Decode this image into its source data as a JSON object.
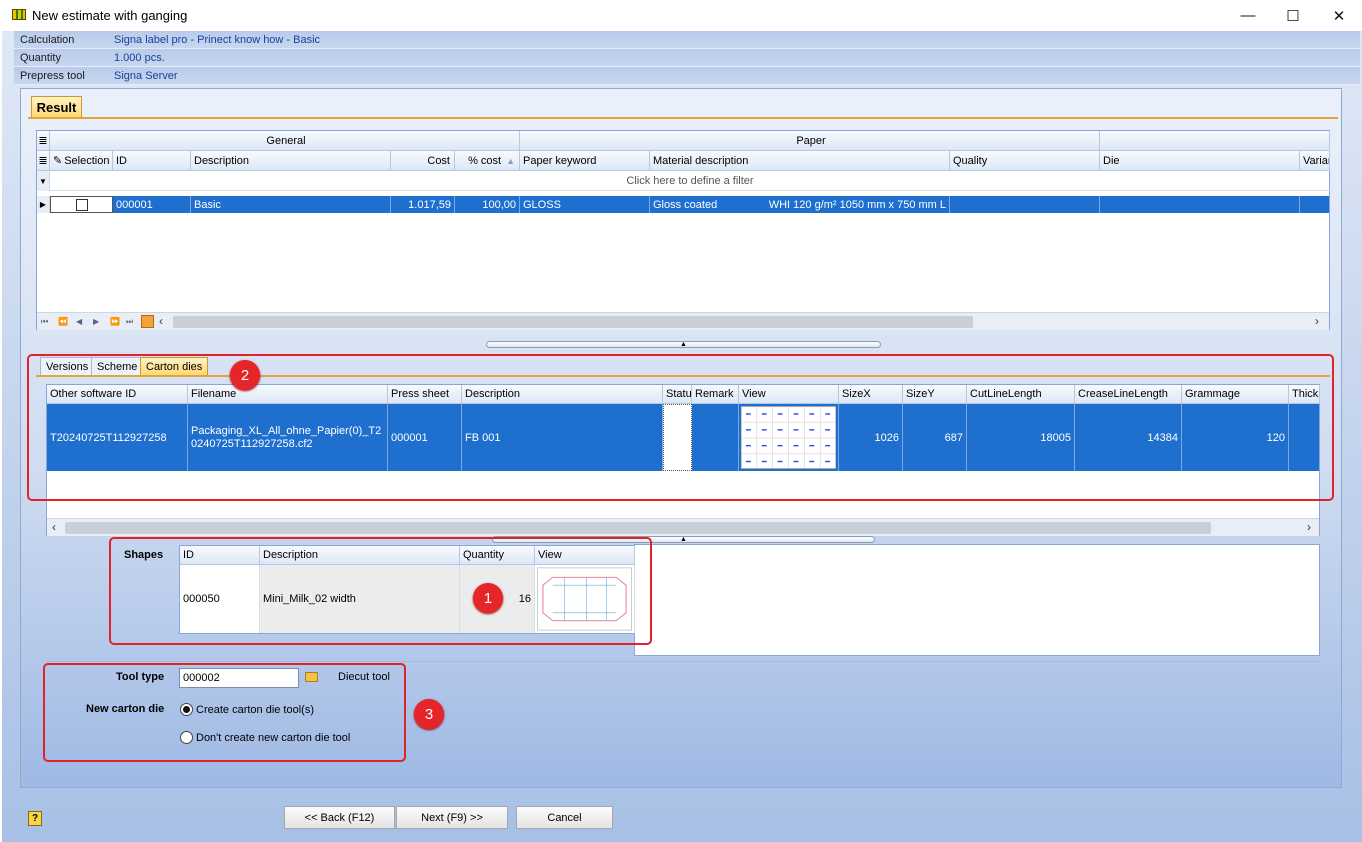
{
  "window": {
    "title": "New estimate with ganging",
    "minimize": "—",
    "maximize": "☐",
    "close": "✕"
  },
  "info": [
    {
      "key": "Calculation",
      "value": "Signa label pro - Prinect know how - Basic"
    },
    {
      "key": "Quantity",
      "value": "1.000 pcs."
    },
    {
      "key": "Prepress tool",
      "value": "Signa Server"
    }
  ],
  "result_tab": "Result",
  "result_grid": {
    "band_general": "General",
    "band_paper": "Paper",
    "columns": [
      "Selection",
      "ID",
      "Description",
      "Cost",
      "% cost",
      "Paper keyword",
      "Material description",
      "Quality",
      "Die",
      "Variant"
    ],
    "filter_text": "Click here to define a filter",
    "row": {
      "selected": true,
      "id": "000001",
      "description": "Basic",
      "cost": "1.017,59",
      "pct_cost": "100,00",
      "paper_keyword": "GLOSS",
      "material_description": "Gloss coated",
      "material_detail": "WHI 120 g/m² 1050 mm x 750 mm L",
      "quality": "",
      "die": "",
      "variant": ""
    }
  },
  "subtabs": [
    "Versions",
    "Scheme",
    "Carton dies"
  ],
  "carton_grid": {
    "columns": [
      "Other software ID",
      "Filename",
      "Press sheet",
      "Description",
      "Status",
      "Remark",
      "View",
      "SizeX",
      "SizeY",
      "CutLineLength",
      "CreaseLineLength",
      "Grammage",
      "Thickness"
    ],
    "row": {
      "other_id": "T20240725T112927258",
      "filename": "Packaging_XL_All_ohne_Papier(0)_T20240725T112927258.cf2",
      "press_sheet": "000001",
      "description": "FB 001",
      "status": "",
      "remark": "",
      "sizex": "1026",
      "sizey": "687",
      "cut": "18005",
      "crease": "14384",
      "grammage": "120"
    }
  },
  "shapes": {
    "label": "Shapes",
    "columns": [
      "ID",
      "Description",
      "Quantity",
      "View"
    ],
    "row": {
      "id": "000050",
      "description": "Mini_Milk_02 width",
      "quantity": "16"
    }
  },
  "tool_type": {
    "label": "Tool type",
    "value": "000002",
    "name": "Diecut tool"
  },
  "new_carton_die": {
    "label": "New carton die",
    "options": [
      {
        "label": "Create carton die tool(s)",
        "checked": true
      },
      {
        "label": "Don't create new carton die tool",
        "checked": false
      }
    ]
  },
  "badges": [
    "1",
    "2",
    "3"
  ],
  "buttons": {
    "back": "<< Back (F12)",
    "next": "Next (F9) >>",
    "cancel": "Cancel"
  },
  "colors": {
    "selection": "#1f6fcf",
    "highlight": "#e0222a",
    "tab_active": "#ffd66f"
  }
}
